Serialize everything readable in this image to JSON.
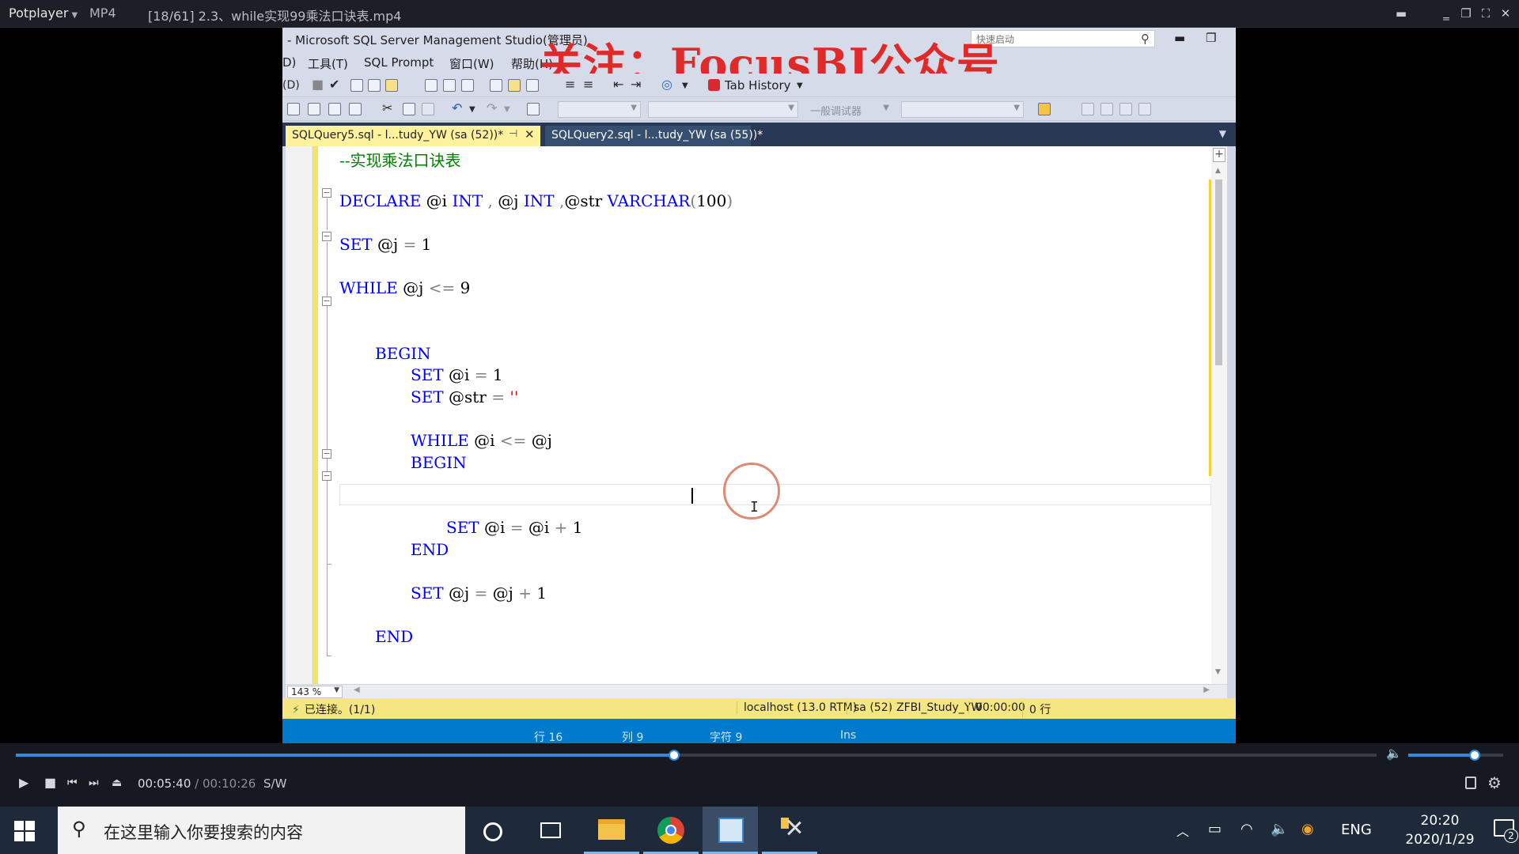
{
  "player": {
    "name": "Potplayer",
    "format": "MP4",
    "file_title": "[18/61] 2.3、while实现99乘法口诀表.mp4",
    "time_current": "00:05:40",
    "time_separator": " / ",
    "time_total": "00:10:26",
    "mode": "S/W",
    "seek_progress": 0.484,
    "volume_level": 0.7
  },
  "watermark": "关注：FocusBI公众号",
  "ssms": {
    "title": "- Microsoft SQL Server Management Studio(管理员)",
    "quick_launch_placeholder": "快速启动",
    "menu": [
      "D)",
      "工具(T)",
      "SQL Prompt",
      "窗口(W)",
      "帮助(H)"
    ],
    "toolbar1_first": "(D)",
    "tab_history": "Tab History",
    "debugger_combo": "一般调试器",
    "tabs": [
      {
        "label": "SQLQuery5.sql - l...tudy_YW (sa (52))*",
        "pin": "⊣",
        "close": "✕"
      },
      {
        "label": "SQLQuery2.sql - l...tudy_YW (sa (55))*"
      }
    ],
    "code": {
      "comment": "--实现乘法口诀表",
      "l2": {
        "kw1": "DECLARE",
        "v1": " @i ",
        "kw2": "INT",
        "g1": " , ",
        "v2": "@j ",
        "kw3": "INT",
        "g2": " ,",
        "v3": "@str ",
        "kw4": "VARCHAR",
        "g3": "(",
        "num": "100",
        "g4": ")"
      },
      "l3": {
        "kw": "SET",
        "v": " @j ",
        "g": "=",
        "n": " 1"
      },
      "l4": {
        "kw": "WHILE",
        "v": " @j ",
        "g": "<=",
        "n": " 9"
      },
      "l5": {
        "kw": "BEGIN"
      },
      "l6": {
        "kw": "SET",
        "v": " @i ",
        "g": "=",
        "n": " 1"
      },
      "l7": {
        "kw": "SET",
        "v": " @str ",
        "g": "=",
        "s": " ''"
      },
      "l8": {
        "kw": "WHILE",
        "v": " @i ",
        "g": "<=",
        "v2": " @j"
      },
      "l9": {
        "kw": "BEGIN"
      },
      "l10": {
        "kw": "SET",
        "v": " @i ",
        "g": "=",
        "v2": " @i ",
        "g2": "+",
        "n": " 1"
      },
      "l11": {
        "kw": "END"
      },
      "l12": {
        "kw": "SET",
        "v": " @j ",
        "g": "=",
        "v2": " @j ",
        "g2": "+",
        "n": " 1"
      },
      "l13": {
        "kw": "END"
      }
    },
    "zoom": "143 %",
    "status": {
      "connection": "已连接。(1/1)",
      "server": "localhost (13.0 RTM)",
      "user": "sa (52)",
      "database": "ZFBI_Study_YW",
      "elapsed": "00:00:00",
      "rows": "0 行"
    },
    "appstatus": {
      "line": "行 16",
      "col": "列 9",
      "char": "字符 9",
      "mode": "Ins"
    }
  },
  "taskbar": {
    "search_placeholder": "在这里输入你要搜索的内容",
    "lang": "ENG",
    "time": "20:20",
    "date": "2020/1/29",
    "notifications": "2"
  }
}
